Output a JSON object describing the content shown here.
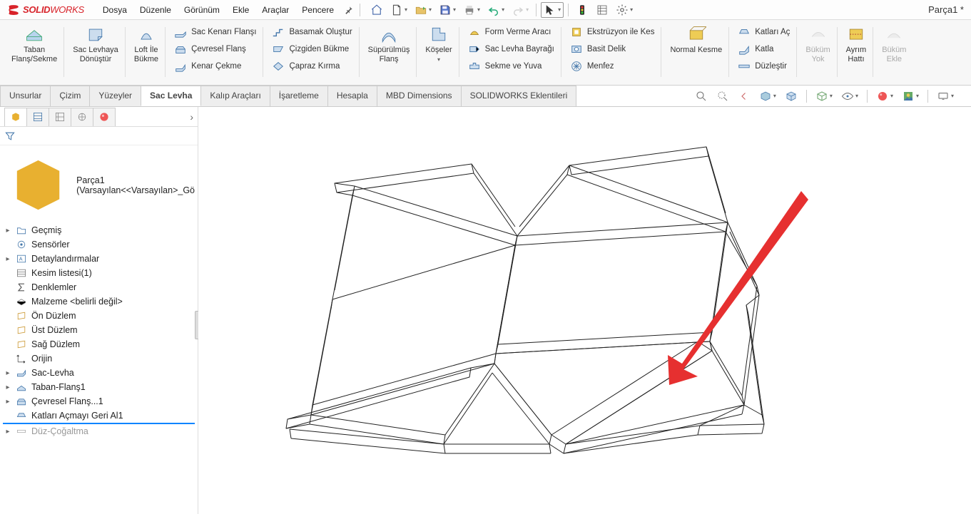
{
  "app": {
    "logo_text": "SOLID",
    "logo_text2": "WORKS"
  },
  "doc_title": "Parça1 *",
  "menu": {
    "dosya": "Dosya",
    "duzenle": "Düzenle",
    "gorunum": "Görünüm",
    "ekle": "Ekle",
    "araclar": "Araçlar",
    "pencere": "Pencere"
  },
  "ribbon": {
    "taban": "Taban\nFlanş/Sekme",
    "donustur": "Sac Levhaya\nDönüştür",
    "loft": "Loft İle\nBükme",
    "sackenari": "Sac Kenarı Flanşı",
    "cevresel": "Çevresel Flanş",
    "kenarcekme": "Kenar Çekme",
    "basamak": "Basamak Oluştur",
    "cizgiden": "Çizgiden Bükme",
    "capraz": "Çapraz Kırma",
    "supurulmus": "Süpürülmüş\nFlanş",
    "koseler": "Köşeler",
    "formverme": "Form Verme Aracı",
    "bayragi": "Sac Levha Bayrağı",
    "sekmeyuva": "Sekme ve Yuva",
    "ekstruzyon": "Ekstrüzyon ile Kes",
    "basitdelik": "Basit Delik",
    "menfez": "Menfez",
    "normalkesme": "Normal Kesme",
    "katlariac": "Katları Aç",
    "katla": "Katla",
    "duzlestir": "Düzleştir",
    "bukumyok": "Büküm\nYok",
    "ayrimhatti": "Ayrım\nHattı",
    "bukumekle": "Büküm\nEkle"
  },
  "tabs": {
    "unsurlar": "Unsurlar",
    "cizim": "Çizim",
    "yuzeyler": "Yüzeyler",
    "saclevha": "Sac Levha",
    "kalip": "Kalıp Araçları",
    "isaretleme": "İşaretleme",
    "hesapla": "Hesapla",
    "mbd": "MBD Dimensions",
    "eklentiler": "SOLIDWORKS Eklentileri"
  },
  "tree": {
    "root": "Parça1  (Varsayılan<<Varsayılan>_Gö",
    "gecmis": "Geçmiş",
    "sensorler": "Sensörler",
    "detay": "Detaylandırmalar",
    "kesim": "Kesim listesi(1)",
    "denklemler": "Denklemler",
    "malzeme": "Malzeme <belirli değil>",
    "on": "Ön Düzlem",
    "ust": "Üst Düzlem",
    "sag": "Sağ Düzlem",
    "orijin": "Orijin",
    "saclevha": "Sac-Levha",
    "tabanflans": "Taban-Flanş1",
    "cevreselflans": "Çevresel Flanş...1",
    "katlarigeri": "Katları Açmayı Geri Al1",
    "duzcogaltma": "Düz-Çoğaltma"
  }
}
